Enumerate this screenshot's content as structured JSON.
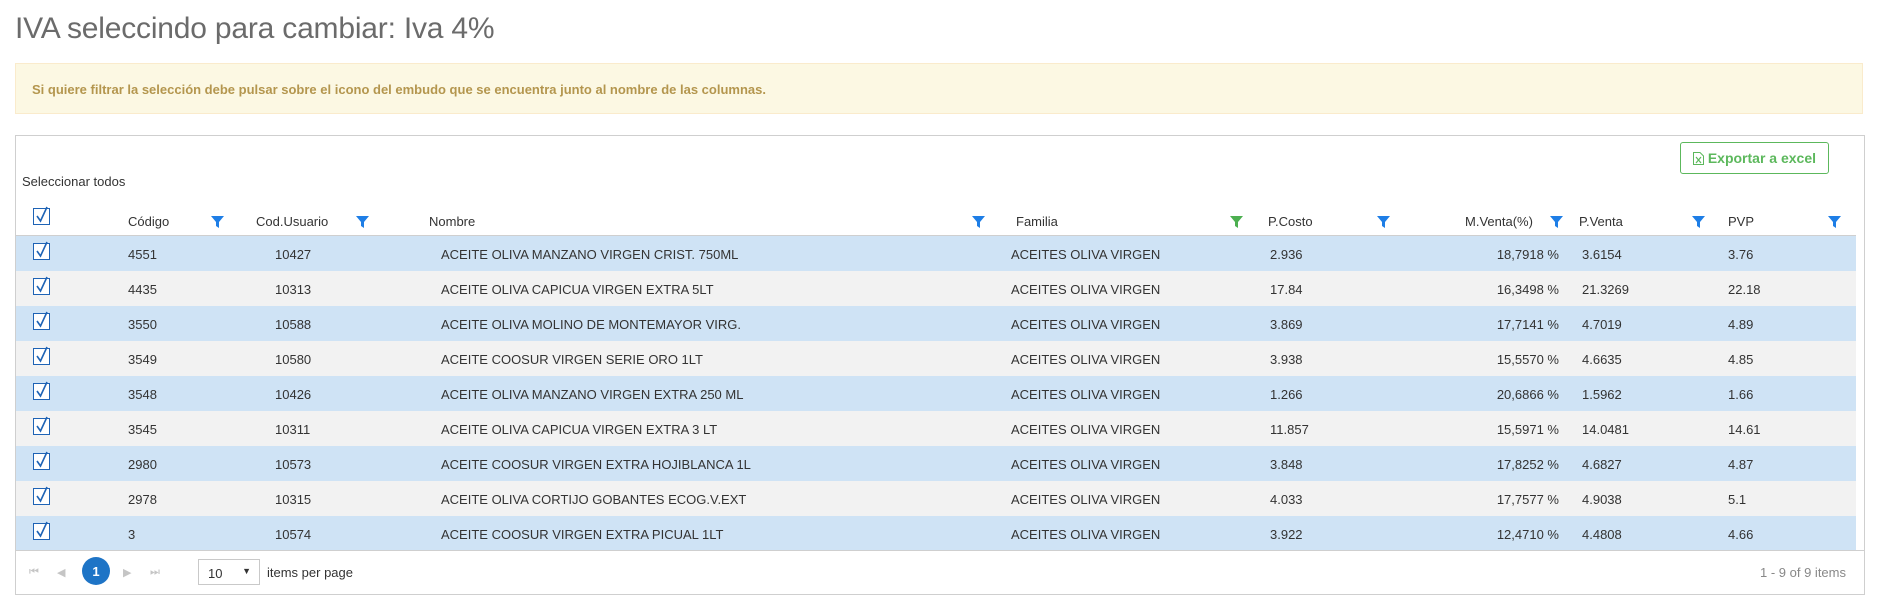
{
  "page": {
    "title": "IVA seleccindo para cambiar: Iva 4%",
    "alert_text": "Si quiere filtrar la selección debe pulsar sobre el icono del embudo que se encuentra junto al nombre de las columnas."
  },
  "toolbar": {
    "export_label": "Exportar a excel",
    "select_all_label": "Seleccionar todos"
  },
  "columns": [
    "Código",
    "Cod.Usuario",
    "Nombre",
    "Familia",
    "P.Costo",
    "M.Venta(%)",
    "P.Venta",
    "PVP"
  ],
  "colors": {
    "funnel": "#1e7ee6",
    "funnel_active": "#4caf50",
    "row_selected": "#cfe3f5",
    "row_alt": "#f2f2f2",
    "accent": "#1e74c6",
    "export": "#5cb85c"
  },
  "rows": [
    {
      "codigo": "4551",
      "cod_usuario": "10427",
      "nombre": "ACEITE OLIVA MANZANO VIRGEN CRIST. 750ML",
      "familia": "ACEITES OLIVA VIRGEN",
      "p_costo": "2.936",
      "m_venta": "18,7918 %",
      "p_venta": "3.6154",
      "pvp": "3.76"
    },
    {
      "codigo": "4435",
      "cod_usuario": "10313",
      "nombre": "ACEITE OLIVA CAPICUA VIRGEN EXTRA 5LT",
      "familia": "ACEITES OLIVA VIRGEN",
      "p_costo": "17.84",
      "m_venta": "16,3498 %",
      "p_venta": "21.3269",
      "pvp": "22.18"
    },
    {
      "codigo": "3550",
      "cod_usuario": "10588",
      "nombre": "ACEITE OLIVA MOLINO DE MONTEMAYOR VIRG.",
      "familia": "ACEITES OLIVA VIRGEN",
      "p_costo": "3.869",
      "m_venta": "17,7141 %",
      "p_venta": "4.7019",
      "pvp": "4.89"
    },
    {
      "codigo": "3549",
      "cod_usuario": "10580",
      "nombre": "ACEITE COOSUR VIRGEN SERIE ORO 1LT",
      "familia": "ACEITES OLIVA VIRGEN",
      "p_costo": "3.938",
      "m_venta": "15,5570 %",
      "p_venta": "4.6635",
      "pvp": "4.85"
    },
    {
      "codigo": "3548",
      "cod_usuario": "10426",
      "nombre": "ACEITE OLIVA MANZANO VIRGEN EXTRA 250 ML",
      "familia": "ACEITES OLIVA VIRGEN",
      "p_costo": "1.266",
      "m_venta": "20,6866 %",
      "p_venta": "1.5962",
      "pvp": "1.66"
    },
    {
      "codigo": "3545",
      "cod_usuario": "10311",
      "nombre": "ACEITE OLIVA CAPICUA VIRGEN EXTRA 3 LT",
      "familia": "ACEITES OLIVA VIRGEN",
      "p_costo": "11.857",
      "m_venta": "15,5971 %",
      "p_venta": "14.0481",
      "pvp": "14.61"
    },
    {
      "codigo": "2980",
      "cod_usuario": "10573",
      "nombre": "ACEITE COOSUR VIRGEN EXTRA HOJIBLANCA 1L",
      "familia": "ACEITES OLIVA VIRGEN",
      "p_costo": "3.848",
      "m_venta": "17,8252 %",
      "p_venta": "4.6827",
      "pvp": "4.87"
    },
    {
      "codigo": "2978",
      "cod_usuario": "10315",
      "nombre": "ACEITE OLIVA CORTIJO GOBANTES ECOG.V.EXT",
      "familia": "ACEITES OLIVA VIRGEN",
      "p_costo": "4.033",
      "m_venta": "17,7577 %",
      "p_venta": "4.9038",
      "pvp": "5.1"
    },
    {
      "codigo": "3",
      "cod_usuario": "10574",
      "nombre": "ACEITE COOSUR VIRGEN EXTRA PICUAL 1LT",
      "familia": "ACEITES OLIVA VIRGEN",
      "p_costo": "3.922",
      "m_venta": "12,4710 %",
      "p_venta": "4.4808",
      "pvp": "4.66"
    }
  ],
  "pager": {
    "first_icon": "first-page-icon",
    "prev_icon": "prev-page-icon",
    "next_icon": "next-page-icon",
    "last_icon": "last-page-icon",
    "current_page": "1",
    "page_size": "10",
    "items_per_page_label": "items per page",
    "info": "1 - 9 of 9 items"
  }
}
